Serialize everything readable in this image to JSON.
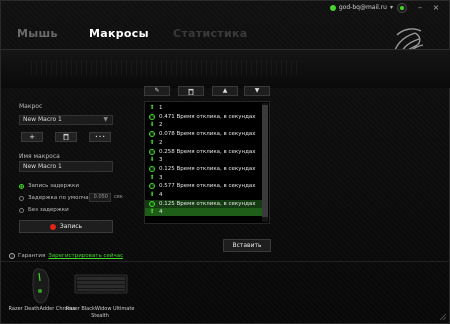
{
  "account": {
    "email": "god-bq@mail.ru"
  },
  "tabs": [
    {
      "label": "Мышь"
    },
    {
      "label": "Макросы"
    },
    {
      "label": "Статистика"
    }
  ],
  "macro": {
    "select_label": "Макрос",
    "selected": "New Macro 1",
    "add_btn": "+",
    "delete_btn": "🗑",
    "more_btn": "• • •",
    "name_label": "Имя макроса",
    "name_value": "New Macro 1",
    "options": [
      {
        "label": "Запись задержки",
        "selected": true
      },
      {
        "label": "Задержка по умолчанию",
        "selected": false,
        "value": "0.050",
        "unit": "сек"
      },
      {
        "label": "Без задержки",
        "selected": false
      }
    ],
    "record_label": "Запись"
  },
  "toolbar": {
    "edit": "✎",
    "delete": "🗑",
    "up": "▲",
    "down": "▼"
  },
  "events": [
    {
      "type": "up",
      "text": "1"
    },
    {
      "type": "delay",
      "text": "0.471 Время отклика, в секундах"
    },
    {
      "type": "down",
      "text": "2"
    },
    {
      "type": "delay",
      "text": "0.078 Время отклика, в секундах"
    },
    {
      "type": "up",
      "text": "2"
    },
    {
      "type": "delay",
      "text": "0.258 Время отклика, в секундах"
    },
    {
      "type": "down",
      "text": "3"
    },
    {
      "type": "delay",
      "text": "0.125 Время отклика, в секундах"
    },
    {
      "type": "up",
      "text": "3"
    },
    {
      "type": "delay",
      "text": "0.577 Время отклика, в секундах"
    },
    {
      "type": "down",
      "text": "4"
    },
    {
      "type": "delay",
      "text": "0.125 Время отклика, в секундах"
    },
    {
      "type": "up",
      "text": "4"
    }
  ],
  "insert_label": "Вставить",
  "footer": {
    "warranty_label": "Гарантия",
    "register_link": "Зарегистрировать сейчас",
    "devices": [
      {
        "name": "Razer DeathAdder Chroma"
      },
      {
        "name": "Razer BlackWidow Ultimate Stealth"
      }
    ]
  },
  "colors": {
    "accent": "#44d62c",
    "record": "#e3241b",
    "background": "#0b0b0b"
  }
}
